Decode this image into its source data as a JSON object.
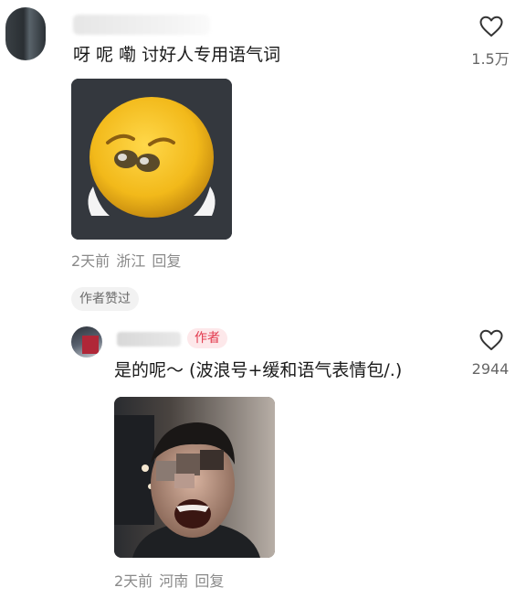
{
  "comments": [
    {
      "text": "呀 呢 嘞 讨好人专用语气词",
      "like_count": "1.5万",
      "image": "crying-emoji-sticker",
      "meta": {
        "time": "2天前",
        "location": "浙江",
        "reply": "回复"
      },
      "author_liked_tag": "作者赞过"
    }
  ],
  "reply": {
    "author_badge": "作者",
    "text": "是的呢～ (波浪号+缓和语气表情包/.)",
    "like_count": "2944",
    "image": "laughing-man-photo",
    "meta": {
      "time": "2天前",
      "location": "河南",
      "reply": "回复"
    }
  },
  "colors": {
    "text": "#1a1a1a",
    "meta": "#8a8a8a",
    "author_badge_bg": "#fde8ea",
    "author_badge_text": "#e23a4e",
    "tag_bg": "#f2f2f2"
  }
}
